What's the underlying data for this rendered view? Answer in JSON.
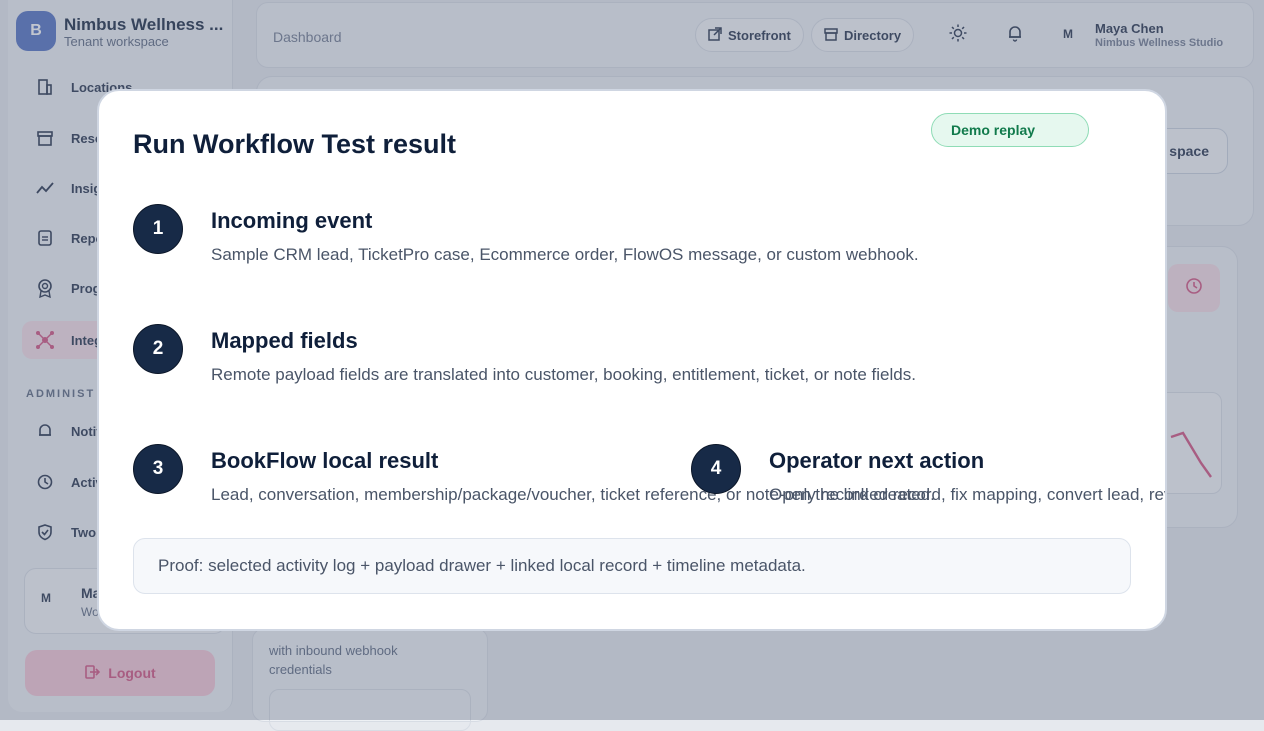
{
  "app": {
    "name": "Nimbus Wellness ...",
    "workspace_type": "Tenant workspace",
    "logo_letter": "B",
    "accent": "#d24b7a"
  },
  "sidebar": {
    "items": [
      {
        "label": "Locations",
        "icon": "building-icon"
      },
      {
        "label": "Reso",
        "icon": "archive-icon"
      },
      {
        "label": "Insig",
        "icon": "trend-icon"
      },
      {
        "label": "Repo",
        "icon": "report-icon"
      },
      {
        "label": "Prog",
        "icon": "award-icon"
      },
      {
        "label": "Integ",
        "icon": "network-icon",
        "active": true
      }
    ],
    "section_label": "ADMINIST",
    "admin_items": [
      {
        "label": "Notifi",
        "icon": "bell-icon"
      },
      {
        "label": "Activ",
        "icon": "history-icon"
      },
      {
        "label": "Two",
        "icon": "shield-icon"
      }
    ],
    "user": {
      "initial": "M",
      "name": "Ma",
      "workspace": "Wo"
    },
    "logout_label": "Logout"
  },
  "topbar": {
    "breadcrumb": "Dashboard",
    "storefront_label": "Storefront",
    "directory_label": "Directory",
    "user": {
      "initial": "M",
      "name": "Maya Chen",
      "workspace": "Nimbus Wellness Studio"
    }
  },
  "hero": {
    "button_label": "space"
  },
  "background_card": {
    "text": "with inbound webhook credentials"
  },
  "modal": {
    "title": "Run Workflow Test result",
    "badge": "Demo replay",
    "steps": [
      {
        "number": "1",
        "title": "Incoming event",
        "description": "Sample CRM lead, TicketPro case, Ecommerce order, FlowOS message, or custom webhook."
      },
      {
        "number": "2",
        "title": "Mapped fields",
        "description": "Remote payload fields are translated into customer, booking, entitlement, ticket, or note fields."
      },
      {
        "number": "3",
        "title": "BookFlow local result",
        "description": "Lead, conversation, membership/package/voucher, ticket reference, or note-only record created."
      },
      {
        "number": "4",
        "title": "Operator next action",
        "description": "Open the linked record, fix mapping, convert lead, review wallet"
      }
    ],
    "proof": "Proof: selected activity log + payload drawer + linked local record + timeline metadata."
  }
}
